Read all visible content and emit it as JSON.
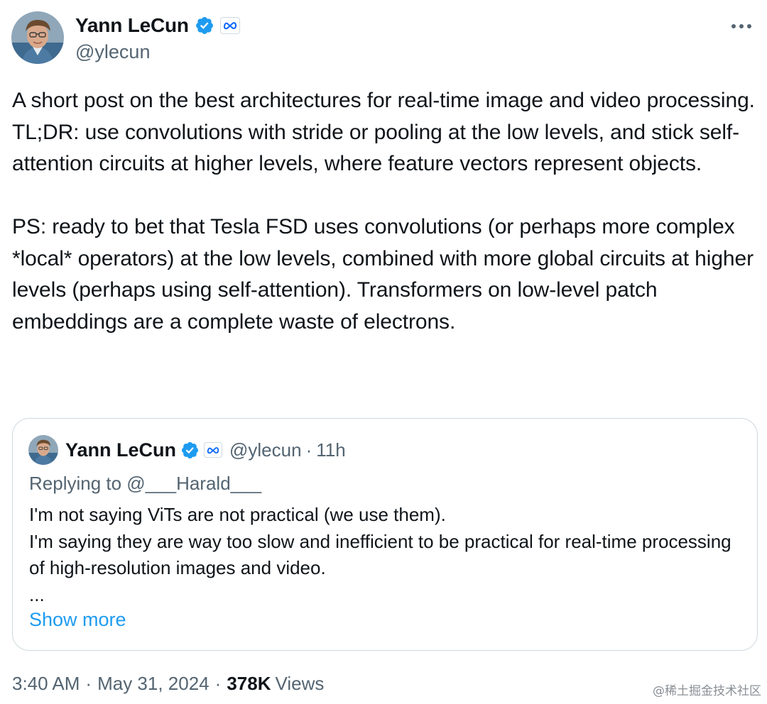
{
  "author": {
    "display_name": "Yann LeCun",
    "handle": "@ylecun",
    "verified_icon": "verified-badge-icon",
    "affiliation_icon": "meta-logo-icon"
  },
  "post": {
    "paragraphs": [
      "A short post on the best architectures for real-time image and video processing.",
      "TL;DR: use convolutions with stride or pooling at the low levels, and stick self-attention circuits at higher levels, where feature vectors represent objects.",
      "PS: ready to bet that Tesla FSD uses convolutions (or perhaps more complex *local* operators) at the low levels, combined with more global circuits at higher levels (perhaps using self-attention). Transformers on low-level patch embeddings are a complete waste of electrons."
    ]
  },
  "quote": {
    "display_name": "Yann LeCun",
    "handle": "@ylecun",
    "separator": "·",
    "time": "11h",
    "replying_to": "Replying to @___Harald___",
    "lines": [
      "I'm not saying ViTs are not practical (we use them).",
      "I'm saying they are way too slow and inefficient to be practical for real-time processing of high-resolution images and video.",
      "..."
    ],
    "show_more": "Show more"
  },
  "footer": {
    "time": "3:40 AM",
    "separator": "·",
    "date": "May 31, 2024",
    "views_count": "378K",
    "views_label": "Views"
  },
  "watermark": "@稀土掘金技术社区",
  "colors": {
    "text": "#0f1419",
    "secondary": "#536471",
    "link": "#1d9bf0",
    "verified": "#1d9bf0",
    "border": "#cfd9de"
  }
}
